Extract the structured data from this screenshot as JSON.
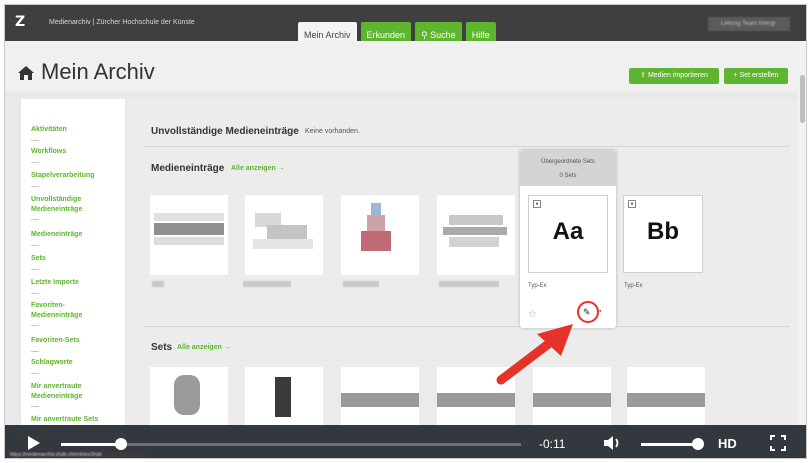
{
  "app": {
    "logo": "Z",
    "site_title": "Medienarchiv | Zürcher Hochschule der Künste",
    "user_label": "Leitung Team Intergr."
  },
  "nav": {
    "tabs": [
      "Mein Archiv",
      "Erkunden",
      "Suche",
      "Hilfe"
    ],
    "active": "Mein Archiv"
  },
  "header": {
    "title": "Mein Archiv",
    "import_label": "Medien importieren",
    "create_set_label": "Set erstellen"
  },
  "sidebar": {
    "items": [
      [
        "Aktivitäten"
      ],
      [
        "Workflows"
      ],
      [
        "Stapelverarbeitung"
      ],
      [
        "Unvollständige",
        "Medieneinträge"
      ],
      [
        "Medieneinträge"
      ],
      [
        "Sets"
      ],
      [
        "Letzte Importe"
      ],
      [
        "Favoriten-",
        "Medieneinträge"
      ],
      [
        "Favoriten-Sets"
      ],
      [
        "Schlagworte"
      ],
      [
        "Mir anvertraute",
        "Medieneinträge"
      ],
      [
        "Mir anvertraute Sets"
      ]
    ]
  },
  "main": {
    "incomplete_title": "Unvollständige Medieneinträge",
    "incomplete_note": "Keine vorhanden.",
    "entries_title": "Medieneinträge",
    "show_all": "Alle anzeigen →",
    "sets_title": "Sets"
  },
  "popover": {
    "title": "Übergeordnete Sets",
    "count": "0 Sets",
    "cards": [
      {
        "letters": "Aa",
        "caption": "Typ-Ex"
      },
      {
        "letters": "Bb",
        "caption": "Typ-Ex"
      }
    ]
  },
  "video": {
    "time": "-0:11",
    "quality": "HD",
    "progress_percent": 13,
    "url_hint": "https://medienarchiv.zhdk.ch/entries/3hde"
  },
  "colors": {
    "accent": "#5fb52f",
    "topbar": "#3f3f3f",
    "annotation": "#e5332a"
  }
}
